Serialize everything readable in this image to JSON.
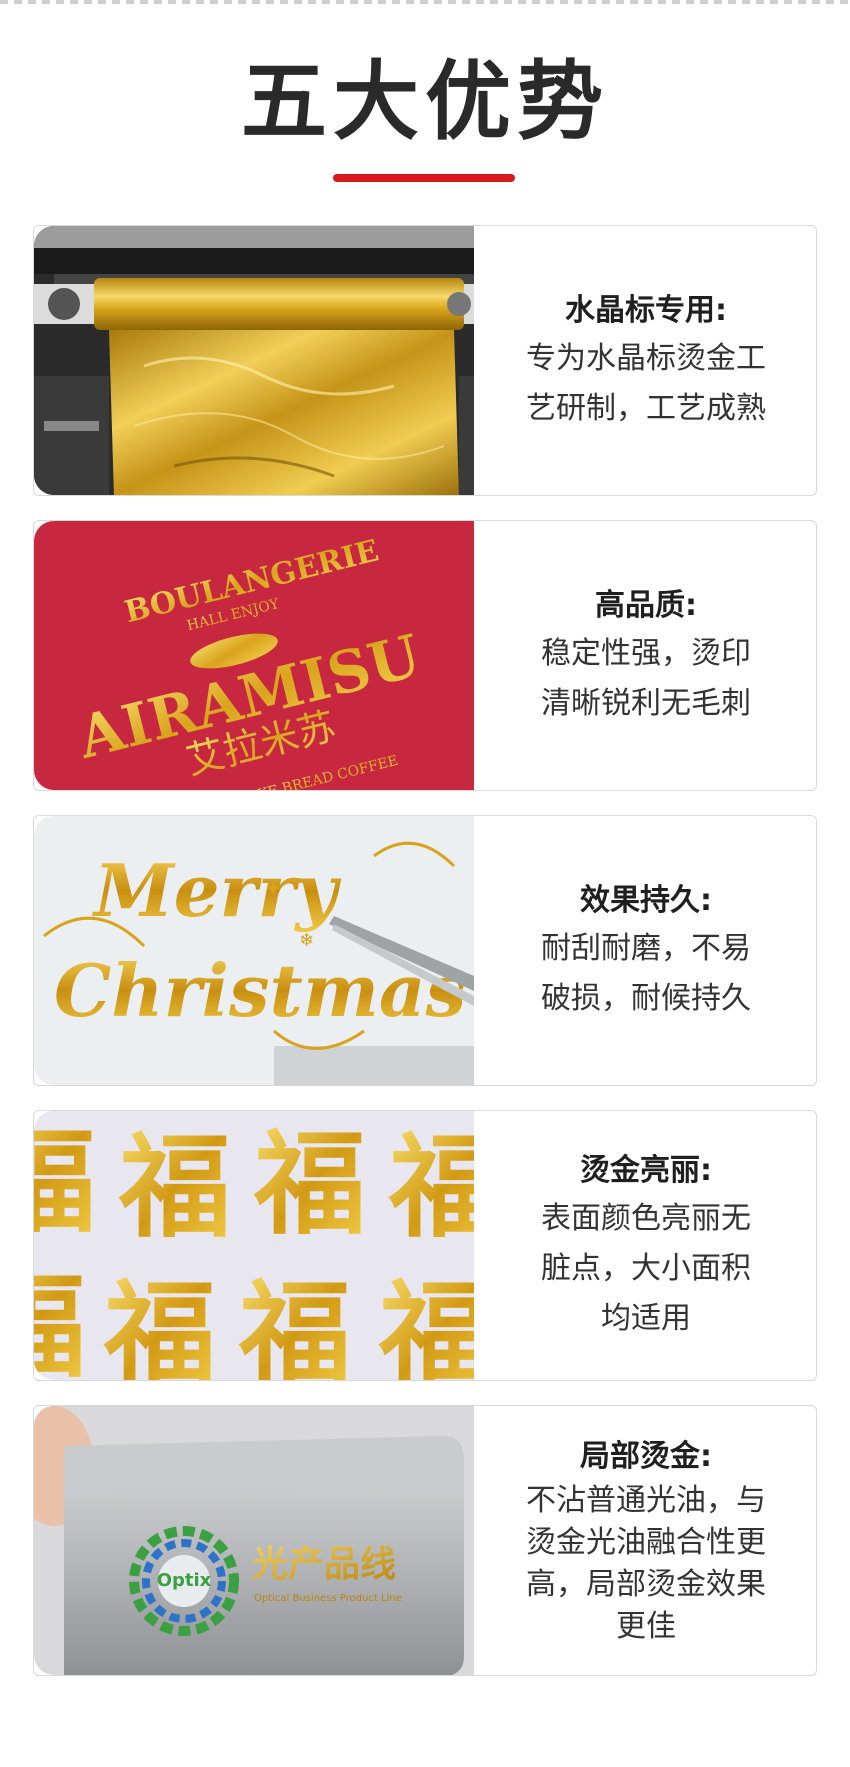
{
  "page": {
    "title": "五大优势"
  },
  "features": [
    {
      "heading": "水晶标专用:",
      "lines": [
        "专为水晶标烫金工",
        "艺研制，工艺成熟"
      ],
      "photo": "gold-foil-roll-machine"
    },
    {
      "heading": "高品质:",
      "lines": [
        "稳定性强，烫印",
        "清晰锐利无毛刺"
      ],
      "photo": "boulangerie-gold-label",
      "photo_text": {
        "top": "BOULANGERIE",
        "sub": "HALL ENJOY",
        "main": "AIRAMISU",
        "cn": "艾拉米苏",
        "bottom": "AKE BREAD COFFEE"
      }
    },
    {
      "heading": "效果持久:",
      "lines": [
        "耐刮耐磨，不易",
        "破损，耐候持久"
      ],
      "photo": "merry-christmas-gold-sticker",
      "photo_text": {
        "line1": "Merry",
        "line2": "Christmas"
      }
    },
    {
      "heading": "烫金亮丽:",
      "lines": [
        "表面颜色亮丽无",
        "脏点，大小面积",
        "均适用"
      ],
      "photo": "fu-character-gold-stickers",
      "photo_text": {
        "char": "福"
      }
    },
    {
      "heading": "局部烫金:",
      "lines": [
        "不沾普通光油，与",
        "烫金光油融合性更",
        "高，局部烫金效果",
        "更佳"
      ],
      "photo": "tin-box-optix-logo",
      "photo_text": {
        "logo": "Optix",
        "cn": "光产品线",
        "en": "Optical Business Product Line"
      }
    }
  ],
  "colors": {
    "accent_red": "#d7181f",
    "gold": "#e2b422",
    "label_red": "#c8283f"
  }
}
